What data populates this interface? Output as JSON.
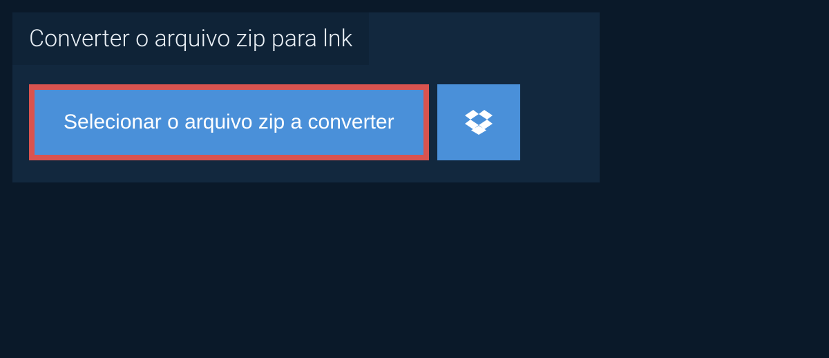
{
  "header": {
    "title": "Converter o arquivo zip para lnk"
  },
  "actions": {
    "select_file_label": "Selecionar o arquivo zip a converter",
    "dropbox_icon_name": "dropbox"
  },
  "colors": {
    "background": "#0a1929",
    "panel": "#12283e",
    "title_bar": "#0f2337",
    "button_primary": "#4a90d9",
    "highlight_border": "#d9534f",
    "text_light": "#e8eef4"
  }
}
